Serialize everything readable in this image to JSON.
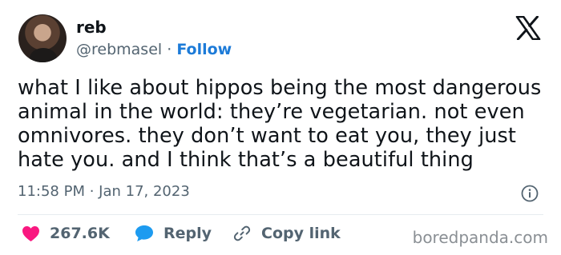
{
  "header": {
    "name": "reb",
    "handle": "@rebmasel",
    "separator": "·",
    "follow_label": "Follow"
  },
  "tweet": {
    "lines": [
      "what I like about hippos being the most dangerous",
      "animal in the world: they’re vegetarian. not even",
      "omnivores. they don’t want to eat you, they just",
      "hate you. and I think that’s a beautiful thing"
    ],
    "timestamp": "11:58 PM · Jan 17, 2023"
  },
  "actions": {
    "likes": "267.6K",
    "reply": "Reply",
    "copy_link": "Copy link"
  },
  "watermark": "boredpanda.com",
  "colors": {
    "text": "#0f1419",
    "secondary": "#536471",
    "link": "#1d7bd8",
    "heart": "#f91880"
  },
  "icons": [
    "x-logo-icon",
    "info-icon",
    "heart-icon",
    "reply-bubble-icon",
    "link-icon"
  ]
}
